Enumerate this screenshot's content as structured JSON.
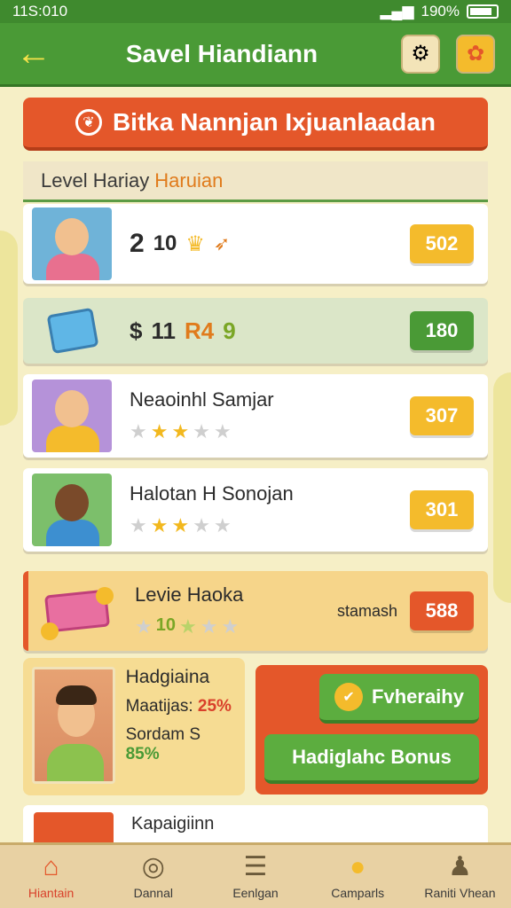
{
  "status": {
    "time": "11S:010",
    "battery": "190%"
  },
  "appbar": {
    "title": "Savel Hiandiann"
  },
  "banner": {
    "text": "Bitka Nannjan Ixjuanlaadan"
  },
  "section": {
    "title": "Level Hariay",
    "accent": "Haruian"
  },
  "rows": [
    {
      "num_a": "2",
      "num_b": "10",
      "score": "502"
    },
    {
      "num_a": "11",
      "num_b": "R4",
      "num_c": "9",
      "score": "180"
    },
    {
      "name": "Neaoinhl Samjar",
      "rating": 2,
      "score": "307"
    },
    {
      "name": "Halotan H Sonojan",
      "rating": 2,
      "score": "301"
    },
    {
      "name": "Levie Haoka",
      "level": "10",
      "tag": "stamash",
      "score": "588"
    }
  ],
  "player": {
    "name": "Hadgiaina",
    "line1_label": "Maatijas:",
    "line1_value": "25%",
    "line2_label": "Sordam S",
    "line2_value": "85%"
  },
  "actions": {
    "primary": "Fvheraihy",
    "secondary": "Hadiglahc Bonus"
  },
  "peek": {
    "title": "Kapaigiinn"
  },
  "nav": [
    {
      "label": "Hiantain",
      "icon": "home-icon"
    },
    {
      "label": "Dannal",
      "icon": "disc-icon"
    },
    {
      "label": "Eenlgan",
      "icon": "list-icon"
    },
    {
      "label": "Camparls",
      "icon": "chat-icon"
    },
    {
      "label": "Raniti Vhean",
      "icon": "person-icon"
    }
  ],
  "colors": {
    "green": "#4a9a36",
    "orange": "#e4572a",
    "yellow": "#f4bb2c"
  }
}
